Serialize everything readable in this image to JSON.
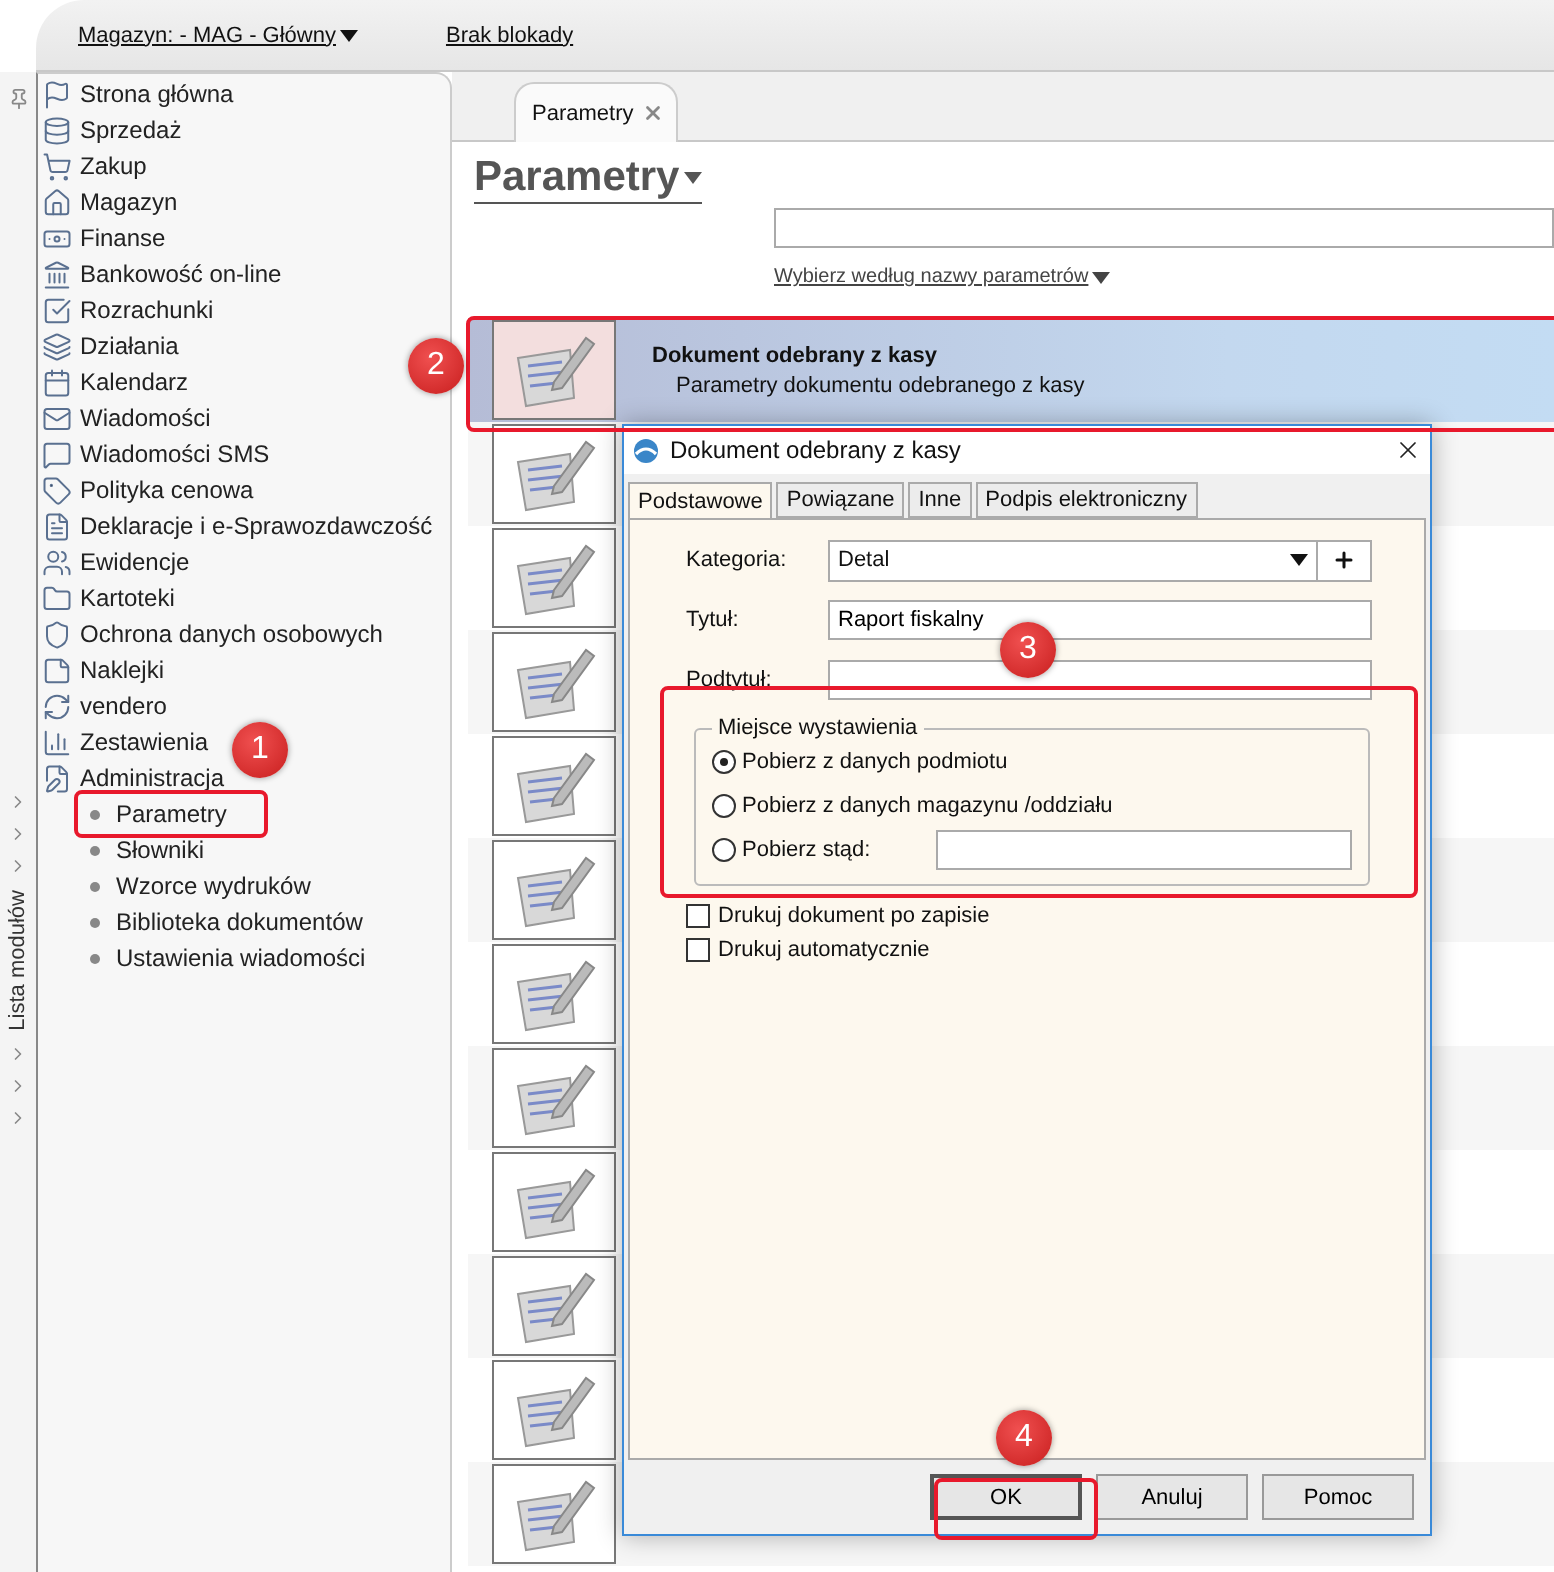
{
  "topbar": {
    "warehouse": "Magazyn: - MAG - Główny",
    "lock_status": "Brak blokady"
  },
  "module_strip": {
    "label": "Lista modułów"
  },
  "sidebar": {
    "items": [
      {
        "label": "Strona główna"
      },
      {
        "label": "Sprzedaż"
      },
      {
        "label": "Zakup"
      },
      {
        "label": "Magazyn"
      },
      {
        "label": "Finanse"
      },
      {
        "label": "Bankowość on-line"
      },
      {
        "label": "Rozrachunki"
      },
      {
        "label": "Działania"
      },
      {
        "label": "Kalendarz"
      },
      {
        "label": "Wiadomości"
      },
      {
        "label": "Wiadomości SMS"
      },
      {
        "label": "Polityka cenowa"
      },
      {
        "label": "Deklaracje i e-Sprawozdawczość"
      },
      {
        "label": "Ewidencje"
      },
      {
        "label": "Kartoteki"
      },
      {
        "label": "Ochrona danych osobowych"
      },
      {
        "label": "Naklejki"
      },
      {
        "label": "vendero"
      },
      {
        "label": "Zestawienia"
      },
      {
        "label": "Administracja",
        "children": [
          {
            "label": "Parametry"
          },
          {
            "label": "Słowniki"
          },
          {
            "label": "Wzorce wydruków"
          },
          {
            "label": "Biblioteka dokumentów"
          },
          {
            "label": "Ustawienia wiadomości"
          }
        ]
      }
    ]
  },
  "tabs": [
    {
      "label": "Parametry",
      "selected": true
    }
  ],
  "heading": "Parametry",
  "search": {
    "filter_link": "Wybierz według nazwy parametrów"
  },
  "parameters": [
    {
      "title": "Dokument odebrany z kasy",
      "description": "Parametry dokumentu odebranego z kasy",
      "selected": true
    },
    {
      "selected": false
    },
    {
      "selected": false
    },
    {
      "selected": false
    },
    {
      "selected": false
    },
    {
      "selected": false
    },
    {
      "selected": false
    },
    {
      "selected": false
    },
    {
      "selected": false
    },
    {
      "selected": false
    },
    {
      "selected": false
    },
    {
      "selected": false
    }
  ],
  "dialog": {
    "title": "Dokument odebrany z kasy",
    "tabs": [
      {
        "label": "Podstawowe",
        "selected": true
      },
      {
        "label": "Powiązane",
        "selected": false
      },
      {
        "label": "Inne",
        "selected": false
      },
      {
        "label": "Podpis elektroniczny",
        "selected": false
      }
    ],
    "fields": [
      {
        "kind": "select",
        "label": "Kategoria:",
        "value": "Detal"
      },
      {
        "kind": "text",
        "label": "Tytuł:",
        "value": "Raport fiskalny"
      },
      {
        "kind": "text",
        "label": "Podtytuł:"
      }
    ],
    "group": {
      "legend": "Miejsce wystawienia",
      "options": [
        {
          "label": "Pobierz z danych podmiotu",
          "selected": true
        },
        {
          "label": "Pobierz z danych magazynu /oddziału",
          "selected": false
        },
        {
          "label": "Pobierz stąd:",
          "selected": false,
          "kind": "input"
        }
      ]
    },
    "checkboxes": [
      {
        "label": "Drukuj dokument po zapisie",
        "checked": false
      },
      {
        "label": "Drukuj automatycznie",
        "checked": false
      }
    ],
    "buttons": [
      {
        "label": "OK",
        "default": true
      },
      {
        "label": "Anuluj",
        "default": false
      },
      {
        "label": "Pomoc",
        "default": false
      }
    ]
  },
  "annotations": [
    {
      "label": "1"
    },
    {
      "label": "2"
    },
    {
      "label": "3"
    },
    {
      "label": "4"
    }
  ]
}
